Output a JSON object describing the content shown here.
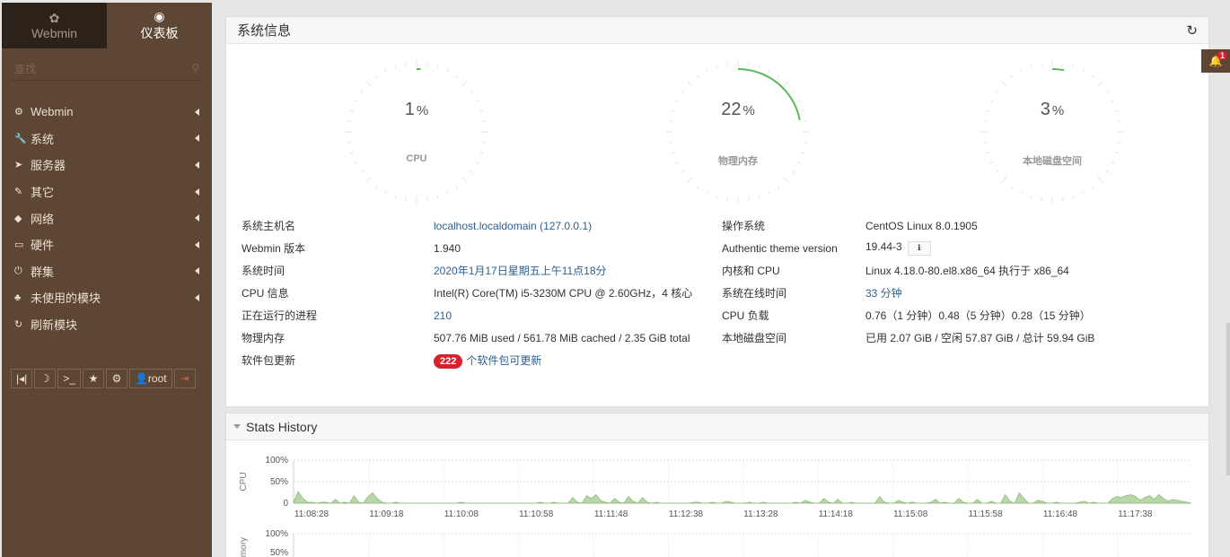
{
  "sidebar": {
    "tabs": [
      {
        "icon": "webmin-logo-icon",
        "label": "Webmin"
      },
      {
        "icon": "dashboard-icon",
        "label": "仪表板"
      }
    ],
    "search_placeholder": "查找",
    "menu": [
      {
        "label": "Webmin",
        "icon": "gear-icon",
        "glyph": "⚙"
      },
      {
        "label": "系统",
        "icon": "wrench-icon",
        "glyph": "🔧"
      },
      {
        "label": "服务器",
        "icon": "rocket-icon",
        "glyph": "➤"
      },
      {
        "label": "其它",
        "icon": "tools-icon",
        "glyph": "✎"
      },
      {
        "label": "网络",
        "icon": "shield-icon",
        "glyph": "◆"
      },
      {
        "label": "硬件",
        "icon": "drive-icon",
        "glyph": "▭"
      },
      {
        "label": "群集",
        "icon": "power-icon",
        "glyph": "⏻"
      },
      {
        "label": "未使用的模块",
        "icon": "puzzle-icon",
        "glyph": "♣"
      },
      {
        "label": "刷新模块",
        "icon": "refresh-icon",
        "glyph": "↻"
      }
    ],
    "toolbar": [
      {
        "name": "collapse-button",
        "glyph": "|◂|"
      },
      {
        "name": "night-mode-button",
        "glyph": "☽"
      },
      {
        "name": "terminal-button",
        "glyph": ">_"
      },
      {
        "name": "favorites-button",
        "glyph": "★"
      },
      {
        "name": "settings-button",
        "glyph": "⚙"
      },
      {
        "name": "user-button",
        "glyph": "👤root"
      },
      {
        "name": "logout-button",
        "glyph": "⇥"
      }
    ]
  },
  "system_info": {
    "title": "系统信息",
    "gauges": [
      {
        "label": "CPU",
        "value": 1,
        "unit": "%"
      },
      {
        "label": "物理内存",
        "value": 22,
        "unit": "%"
      },
      {
        "label": "本地磁盘空间",
        "value": 3,
        "unit": "%"
      }
    ],
    "left_rows": [
      {
        "label": "系统主机名",
        "value": "localhost.localdomain (127.0.0.1)",
        "link": true
      },
      {
        "label": "Webmin 版本",
        "value": "1.940",
        "link": false
      },
      {
        "label": "系统时间",
        "value": "2020年1月17日星期五上午11点18分",
        "link": true
      },
      {
        "label": "CPU 信息",
        "value": "Intel(R) Core(TM) i5-3230M CPU @ 2.60GHz，4 核心",
        "link": false
      },
      {
        "label": "正在运行的进程",
        "value": "210",
        "link": true
      },
      {
        "label": "物理内存",
        "value": "507.76 MiB used / 561.78 MiB cached / 2.35 GiB total",
        "link": false
      },
      {
        "label": "软件包更新",
        "badge": "222",
        "value": "个软件包可更新",
        "link": true
      }
    ],
    "right_rows": [
      {
        "label": "操作系统",
        "value": "CentOS Linux 8.0.1905",
        "link": false
      },
      {
        "label": "Authentic theme version",
        "value": "19.44-3",
        "link": false,
        "info": true
      },
      {
        "label": "内核和 CPU",
        "value": "Linux 4.18.0-80.el8.x86_64 执行于 x86_64",
        "link": false
      },
      {
        "label": "系统在线时间",
        "value": "33 分钟",
        "link": true
      },
      {
        "label": "CPU 负载",
        "value": "0.76（1 分钟）0.48（5 分钟）0.28（15 分钟）",
        "link": false
      },
      {
        "label": "本地磁盘空间",
        "value": "已用 2.07 GiB / 空闲 57.87 GiB / 总计 59.94 GiB",
        "link": false
      }
    ]
  },
  "stats": {
    "title": "Stats History",
    "cpu_label": "CPU",
    "mem_label": "Memory",
    "y_ticks": [
      "100%",
      "50%",
      "0"
    ],
    "x_ticks": [
      "11:08:28",
      "11:09:18",
      "11:10:08",
      "11:10:58",
      "11:11:48",
      "11:12:38",
      "11:13:28",
      "11:14:18",
      "11:15:08",
      "11:15:58",
      "11:16:48",
      "11:17:38"
    ],
    "cpu_series": [
      2,
      12,
      5,
      1,
      1,
      0,
      1,
      1,
      0,
      4,
      0,
      1,
      0,
      8,
      1,
      0,
      7,
      11,
      5,
      1,
      0,
      0,
      1,
      0,
      0,
      0,
      0,
      0,
      0,
      0,
      0,
      0,
      0,
      0,
      0,
      0,
      1,
      0,
      0,
      0,
      0,
      0,
      0,
      0,
      0,
      0,
      0,
      0,
      0,
      0,
      0,
      0,
      0,
      1,
      0,
      0,
      1,
      0,
      0,
      0,
      6,
      1,
      0,
      8,
      5,
      9,
      3,
      1,
      0,
      5,
      1,
      0,
      7,
      2,
      0,
      6,
      1,
      0,
      1,
      0,
      0,
      0,
      0,
      0,
      0,
      0,
      1,
      1,
      0,
      0,
      1,
      0,
      0,
      2,
      1,
      0,
      0,
      0,
      1,
      0,
      0,
      1,
      0,
      0,
      0,
      0,
      0,
      0,
      1,
      0,
      3,
      1,
      0,
      0,
      5,
      1,
      0,
      4,
      0,
      0,
      1,
      0,
      0,
      0,
      0,
      0,
      7,
      1,
      0,
      0,
      3,
      1,
      0,
      1,
      0,
      0,
      0,
      1,
      4,
      0,
      1,
      0,
      0,
      5,
      1,
      0,
      0,
      4,
      0,
      0,
      2,
      0,
      0,
      9,
      2,
      0,
      11,
      5,
      0,
      0,
      3,
      2,
      0,
      0,
      1,
      0,
      0,
      0,
      0,
      1,
      2,
      0,
      1,
      0,
      0,
      0,
      5,
      7,
      6,
      8,
      9,
      7,
      3,
      6,
      8,
      4,
      9,
      5,
      2,
      4,
      3,
      2,
      1,
      0
    ]
  }
}
